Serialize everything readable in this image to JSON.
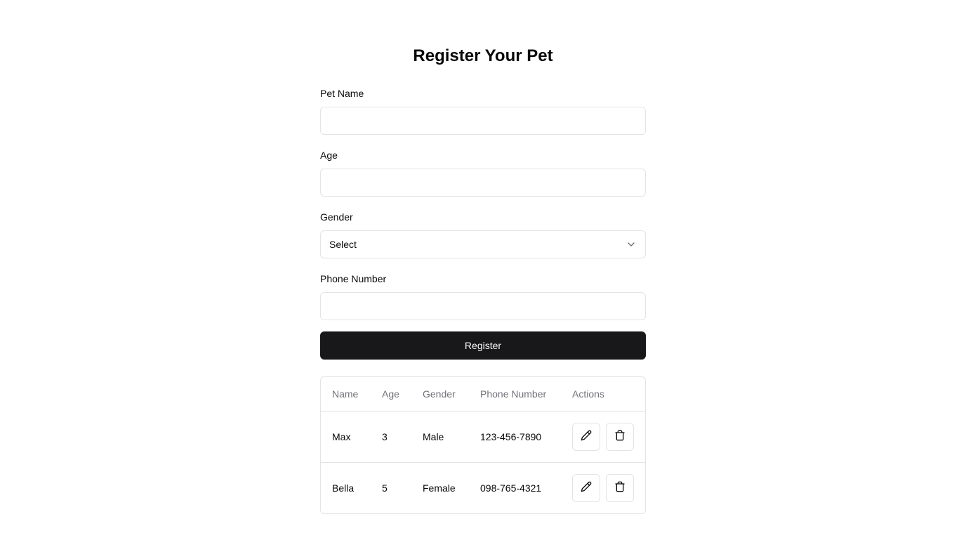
{
  "page": {
    "title": "Register Your Pet"
  },
  "form": {
    "pet_name": {
      "label": "Pet Name",
      "value": "",
      "placeholder": ""
    },
    "age": {
      "label": "Age",
      "value": "",
      "placeholder": ""
    },
    "gender": {
      "label": "Gender",
      "selected": "Select"
    },
    "phone": {
      "label": "Phone Number",
      "value": "",
      "placeholder": ""
    },
    "submit_label": "Register"
  },
  "table": {
    "headers": [
      "Name",
      "Age",
      "Gender",
      "Phone Number",
      "Actions"
    ],
    "rows": [
      {
        "name": "Max",
        "age": "3",
        "gender": "Male",
        "phone": "123-456-7890"
      },
      {
        "name": "Bella",
        "age": "5",
        "gender": "Female",
        "phone": "098-765-4321"
      }
    ]
  },
  "icons": {
    "edit": "pencil-icon",
    "delete": "trash-icon",
    "dropdown": "chevron-down-icon"
  }
}
